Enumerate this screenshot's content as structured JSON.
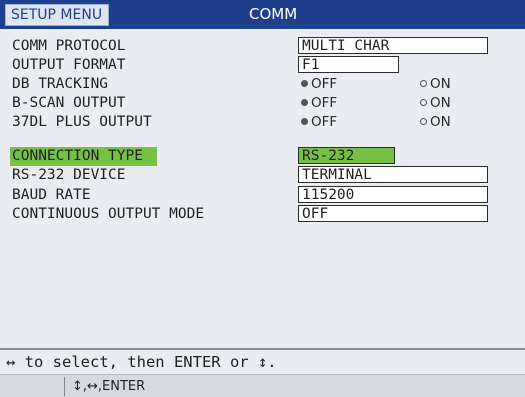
{
  "header": {
    "menu_label": "SETUP MENU",
    "title": "COMM"
  },
  "rows": [
    {
      "label": "COMM PROTOCOL",
      "value": "MULTI CHAR"
    },
    {
      "label": "OUTPUT FORMAT",
      "value": "F1"
    },
    {
      "label": "DB TRACKING",
      "off_label": "OFF",
      "on_label": "ON",
      "selected": "OFF"
    },
    {
      "label": "B-SCAN OUTPUT",
      "off_label": "OFF",
      "on_label": "ON",
      "selected": "OFF"
    },
    {
      "label": "37DL PLUS OUTPUT",
      "off_label": "OFF",
      "on_label": "ON",
      "selected": "OFF"
    },
    {
      "label": "CONNECTION TYPE",
      "value": "RS-232",
      "highlighted": true
    },
    {
      "label": "RS-232 DEVICE",
      "value": "TERMINAL"
    },
    {
      "label": "BAUD RATE",
      "value": "115200"
    },
    {
      "label": "CONTINUOUS OUTPUT MODE",
      "value": "OFF"
    }
  ],
  "help_text": "↔ to select, then ENTER or ↕.",
  "key_hints": "↕,↔,ENTER",
  "colors": {
    "header_bg": "#1e3f8c",
    "highlight": "#76c043",
    "background": "#e9ecf1"
  }
}
